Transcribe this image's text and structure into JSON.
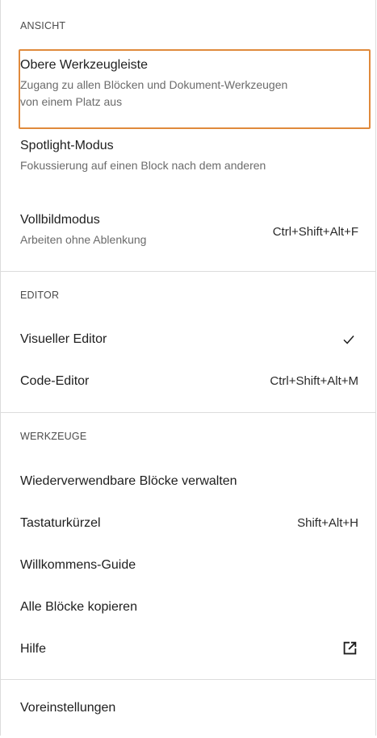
{
  "groups": {
    "view": {
      "title": "ANSICHT",
      "items": [
        {
          "label": "Obere Werkzeugleiste",
          "desc": "Zugang zu allen Blöcken und Dokument-Werkzeugen von einem Platz aus",
          "focused": true
        },
        {
          "label": "Spotlight-Modus",
          "desc": "Fokussierung auf einen Block nach dem anderen"
        },
        {
          "label": "Vollbildmodus",
          "desc": "Arbeiten ohne Ablenkung",
          "shortcut": "Ctrl+Shift+Alt+F"
        }
      ]
    },
    "editor": {
      "title": "EDITOR",
      "items": [
        {
          "label": "Visueller Editor",
          "checked": true,
          "icon": "checkmark-icon"
        },
        {
          "label": "Code-Editor",
          "shortcut": "Ctrl+Shift+Alt+M"
        }
      ]
    },
    "tools": {
      "title": "WERKZEUGE",
      "items": [
        {
          "label": "Wiederverwendbare Blöcke verwalten"
        },
        {
          "label": "Tastaturkürzel",
          "shortcut": "Shift+Alt+H"
        },
        {
          "label": "Willkommens-Guide"
        },
        {
          "label": "Alle Blöcke kopieren"
        },
        {
          "label": "Hilfe",
          "icon": "external-link-icon"
        }
      ]
    },
    "settings": {
      "items": [
        {
          "label": "Voreinstellungen"
        }
      ]
    }
  },
  "colors": {
    "focus_ring": "#e08a3c",
    "divider": "#dcdcdc",
    "description_text": "#6b6b6b"
  }
}
